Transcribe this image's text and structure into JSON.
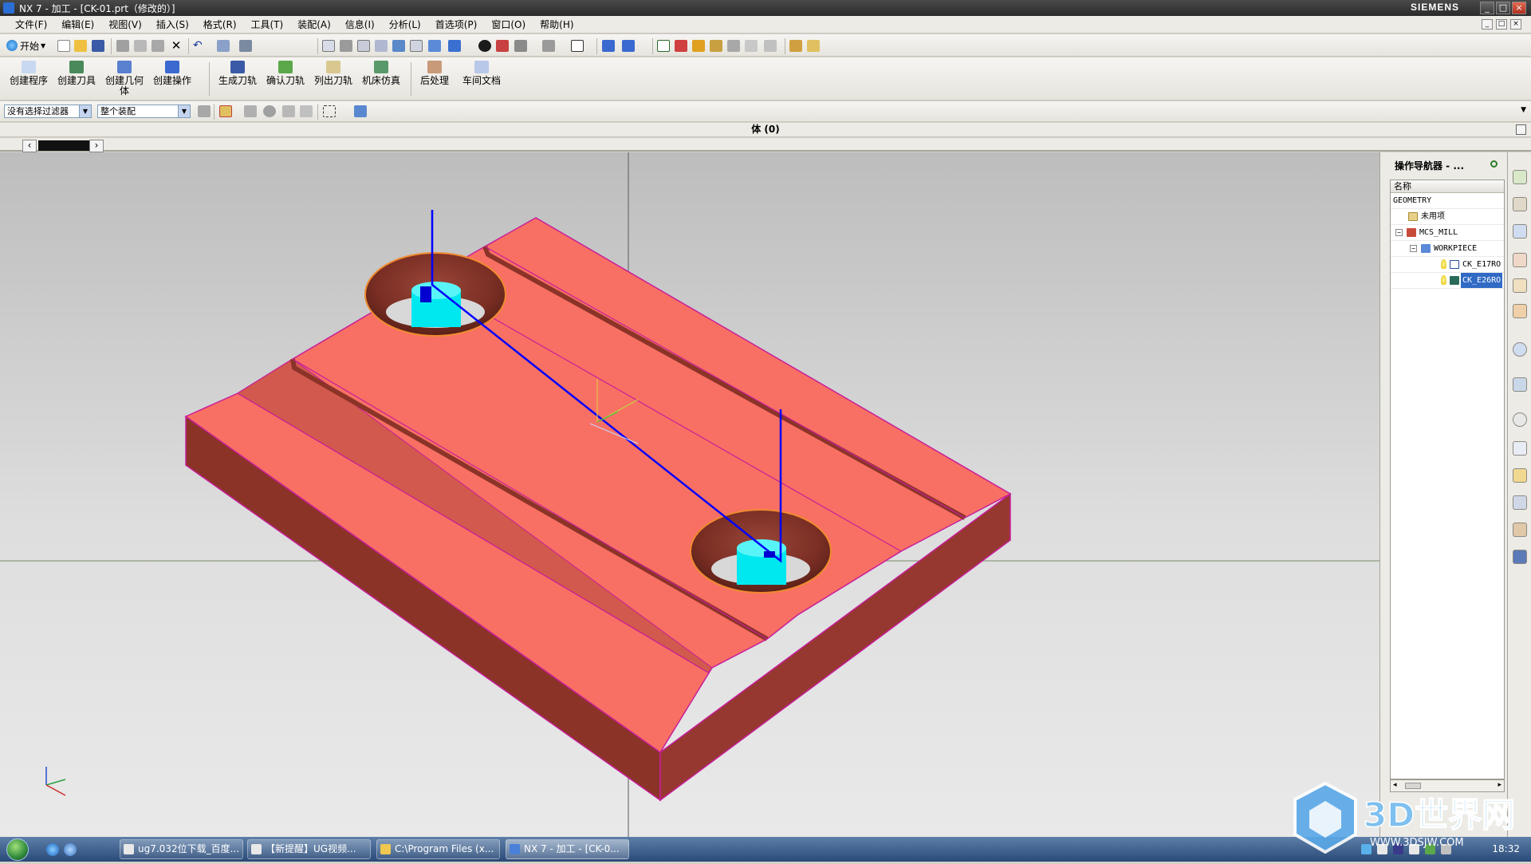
{
  "window": {
    "title": "NX 7 - 加工 - [CK-01.prt（修改的）]",
    "brand": "SIEMENS",
    "controls": [
      "_",
      "□",
      "×"
    ]
  },
  "menubar": {
    "items": [
      "文件(F)",
      "编辑(E)",
      "视图(V)",
      "插入(S)",
      "格式(R)",
      "工具(T)",
      "装配(A)",
      "信息(I)",
      "分析(L)",
      "首选项(P)",
      "窗口(O)",
      "帮助(H)"
    ]
  },
  "standard_toolbar": {
    "start_label": "开始"
  },
  "mfg_toolbar": {
    "buttons": [
      "创建程序",
      "创建刀具",
      "创建几何体",
      "创建操作",
      "生成刀轨",
      "确认刀轨",
      "列出刀轨",
      "机床仿真",
      "后处理",
      "车间文档"
    ]
  },
  "selection_bar": {
    "filter_value": "没有选择过滤器",
    "scope_value": "整个装配"
  },
  "cue_line": {
    "text": "体 (0)"
  },
  "viewport": {
    "colors": {
      "part_top": "#f87063",
      "part_side": "#8c3328",
      "part_edge": "#c81e9a",
      "tool_body": "#00e8ef",
      "toolpath": "#0000ff"
    }
  },
  "navigator": {
    "title": "操作导航器 - ...",
    "column_header": "名称",
    "tree": [
      {
        "label": "GEOMETRY",
        "icon": "none"
      },
      {
        "label": "未用项",
        "icon": "folder-icon"
      },
      {
        "label": "MCS_MILL",
        "icon": "mcs-icon"
      },
      {
        "label": "WORKPIECE",
        "icon": "workpiece-icon"
      },
      {
        "label": "CK_E17RO",
        "icon": "operation-icon"
      },
      {
        "label": "CK_E26RO",
        "icon": "operation-icon"
      }
    ]
  },
  "taskbar": {
    "tasks": [
      "ug7.032位下载_百度...",
      "【新提醒】UG视频...",
      "C:\\Program Files (x...",
      "NX 7 - 加工 - [CK-0..."
    ],
    "clock": "18:32"
  },
  "watermark": {
    "text": "3D世界网",
    "url": "WWW.3DSJW.COM"
  }
}
